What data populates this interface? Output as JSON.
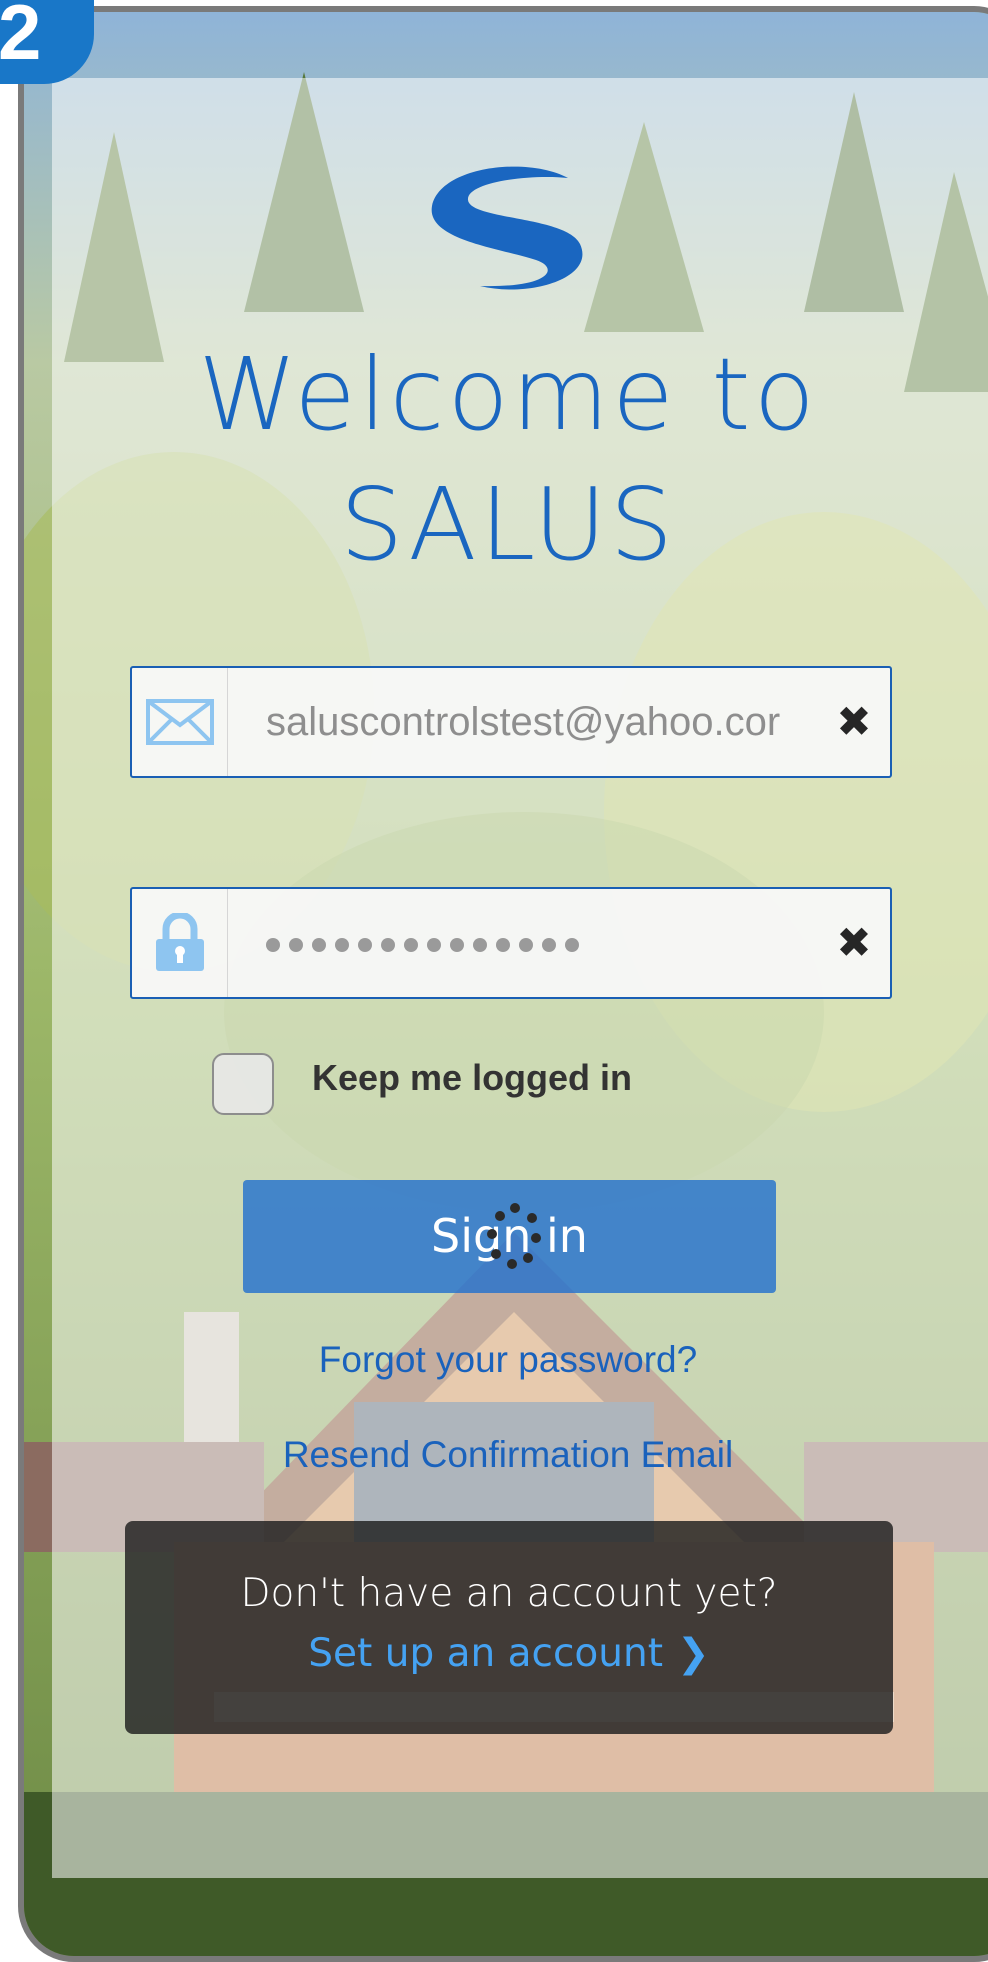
{
  "step_badge": "2",
  "title_line1": "Welcome to",
  "title_line2": "SALUS",
  "email": {
    "value": "saluscontrolstest@yahoo.cor",
    "icon": "mail-icon",
    "clear_icon": "✖"
  },
  "password": {
    "masked_value": "••••••••••••••",
    "icon": "lock-icon",
    "clear_icon": "✖"
  },
  "keep_logged_in": {
    "label": "Keep me logged in",
    "checked": false
  },
  "sign_in_label": "Sign in",
  "forgot_password": "Forgot your password?",
  "resend_confirmation": "Resend Confirmation Email",
  "signup": {
    "question": "Don't have an account yet?",
    "link": "Set up an account",
    "chevron": "❯"
  },
  "colors": {
    "brand_blue": "#1a66c0",
    "button_blue": "#2572cd",
    "link_blue": "#45a2f2",
    "field_border": "#1a5fb4"
  }
}
